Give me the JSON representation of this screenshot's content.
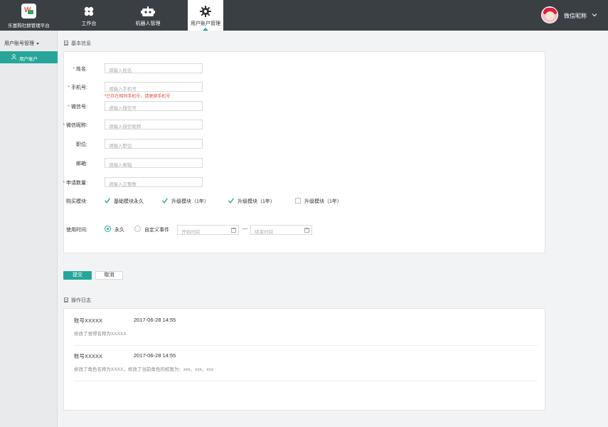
{
  "app": {
    "title": "乐富购社群管理平台"
  },
  "topnav": {
    "items": [
      {
        "label": "工作台",
        "icon": "workbench-icon"
      },
      {
        "label": "机器人管理",
        "icon": "robot-icon"
      },
      {
        "label": "用户账户管理",
        "icon": "gear-icon",
        "active": true
      }
    ],
    "user": {
      "name": "微信昵称"
    }
  },
  "sidebar": {
    "group": "用户账号管理",
    "items": [
      {
        "label": "用户账户",
        "active": true
      }
    ]
  },
  "basic_info": {
    "title": "基本信息",
    "fields": [
      {
        "label": "姓名:",
        "required": true,
        "placeholder": "请输入姓名"
      },
      {
        "label": "手机号:",
        "required": true,
        "placeholder": "请输入手机号",
        "error": "*已存在相同手机号，请更换手机号"
      },
      {
        "label": "微信号:",
        "required": true,
        "placeholder": "请输入微信号"
      },
      {
        "label": "微信昵称:",
        "required": true,
        "placeholder": "请输入微信昵称"
      },
      {
        "label": "职位:",
        "required": false,
        "placeholder": "请输入职位"
      },
      {
        "label": "邮箱:",
        "required": false,
        "placeholder": "请输入邮箱"
      },
      {
        "label": "申请数量:",
        "required": true,
        "placeholder": "请输入正整数"
      }
    ],
    "modules": {
      "label": "购买模块:",
      "options": [
        {
          "label": "基础模块永久",
          "checked": true
        },
        {
          "label": "升级模块（1年）",
          "checked": true
        },
        {
          "label": "升级模块（1年）",
          "checked": true
        },
        {
          "label": "升级模块（1年）",
          "checked": false
        }
      ]
    },
    "usage_time": {
      "label": "使用时间:",
      "options": [
        {
          "label": "永久",
          "selected": true
        },
        {
          "label": "自定义事件",
          "selected": false
        }
      ],
      "start_placeholder": "开始时间",
      "separator": "—",
      "end_placeholder": "结束时间"
    }
  },
  "actions": {
    "submit": "提交",
    "cancel": "取消"
  },
  "log": {
    "title": "操作日志",
    "entries": [
      {
        "account": "账号XXXXX",
        "time": "2017-06-28  14:55",
        "desc": "修改了觉得名称为XXXXX"
      },
      {
        "account": "账号XXXXX",
        "time": "2017-06-28  14:55",
        "desc": "修改了角色名称为XXXX，修改了当前角色的权限为：xxx、xxx、xxx"
      }
    ]
  },
  "colors": {
    "accent": "#26a69a",
    "nav_bg": "#3a3f44",
    "error": "#e74c3c"
  }
}
